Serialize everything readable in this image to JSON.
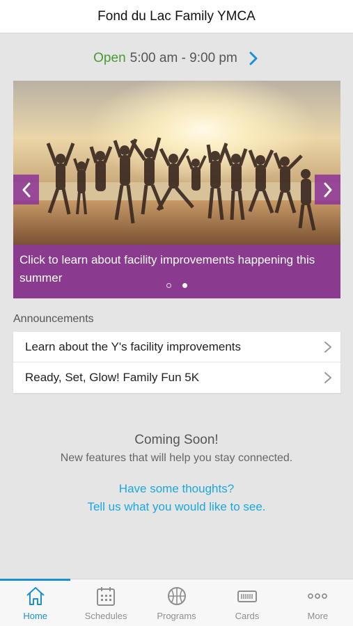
{
  "header": {
    "title": "Fond du Lac Family YMCA"
  },
  "hours": {
    "status": "Open",
    "range": "5:00 am - 9:00 pm"
  },
  "carousel": {
    "caption": "Click to learn about facility improvements happening this summer",
    "slide_count": 2,
    "active_slide": 2
  },
  "announcements": {
    "label": "Announcements",
    "items": [
      {
        "label": "Learn about the Y's facility improvements"
      },
      {
        "label": "Ready, Set, Glow! Family Fun 5K"
      }
    ]
  },
  "coming_soon": {
    "heading": "Coming Soon!",
    "subtext": "New features that will help you stay connected."
  },
  "feedback": {
    "line1": "Have some thoughts?",
    "line2": "Tell us what you would like to see."
  },
  "tabs": [
    {
      "label": "Home",
      "icon": "home-icon",
      "active": true
    },
    {
      "label": "Schedules",
      "icon": "calendar-icon",
      "active": false
    },
    {
      "label": "Programs",
      "icon": "basketball-icon",
      "active": false
    },
    {
      "label": "Cards",
      "icon": "card-icon",
      "active": false
    },
    {
      "label": "More",
      "icon": "more-icon",
      "active": false
    }
  ],
  "colors": {
    "accent": "#1a8fd6",
    "open_green": "#4a9a34",
    "caption_purple": "#8b3b8f",
    "link_blue": "#1aa7dd"
  }
}
